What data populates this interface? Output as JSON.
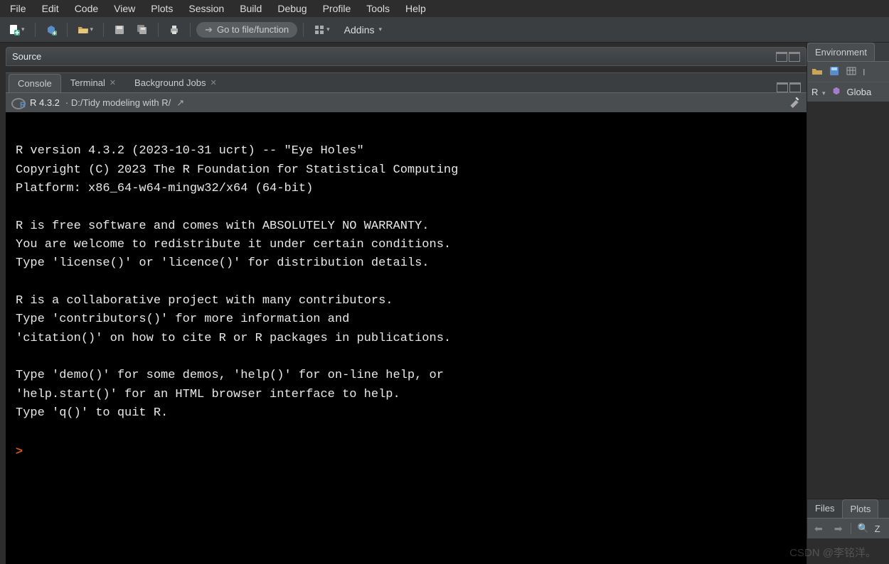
{
  "menubar": [
    "File",
    "Edit",
    "Code",
    "View",
    "Plots",
    "Session",
    "Build",
    "Debug",
    "Profile",
    "Tools",
    "Help"
  ],
  "toolbar": {
    "goto_placeholder": "Go to file/function",
    "addins_label": "Addins"
  },
  "source_pane": {
    "title": "Source"
  },
  "console_pane": {
    "tabs": [
      {
        "label": "Console",
        "closable": false,
        "active": true
      },
      {
        "label": "Terminal",
        "closable": true,
        "active": false
      },
      {
        "label": "Background Jobs",
        "closable": true,
        "active": false
      }
    ],
    "r_version": "R 4.3.2",
    "working_dir": "D:/Tidy modeling with R/",
    "output_lines": [
      "",
      "R version 4.3.2 (2023-10-31 ucrt) -- \"Eye Holes\"",
      "Copyright (C) 2023 The R Foundation for Statistical Computing",
      "Platform: x86_64-w64-mingw32/x64 (64-bit)",
      "",
      "R is free software and comes with ABSOLUTELY NO WARRANTY.",
      "You are welcome to redistribute it under certain conditions.",
      "Type 'license()' or 'licence()' for distribution details.",
      "",
      "R is a collaborative project with many contributors.",
      "Type 'contributors()' for more information and",
      "'citation()' on how to cite R or R packages in publications.",
      "",
      "Type 'demo()' for some demos, 'help()' for on-line help, or",
      "'help.start()' for an HTML browser interface to help.",
      "Type 'q()' to quit R.",
      ""
    ],
    "prompt": ">"
  },
  "right_top": {
    "tabs": [
      {
        "label": "Environment",
        "active": true
      }
    ],
    "scope_label": "R",
    "env_label": "Globa"
  },
  "right_bottom": {
    "tabs": [
      {
        "label": "Files",
        "active": false
      },
      {
        "label": "Plots",
        "active": true
      }
    ]
  },
  "watermark": "CSDN @李铭洋。"
}
